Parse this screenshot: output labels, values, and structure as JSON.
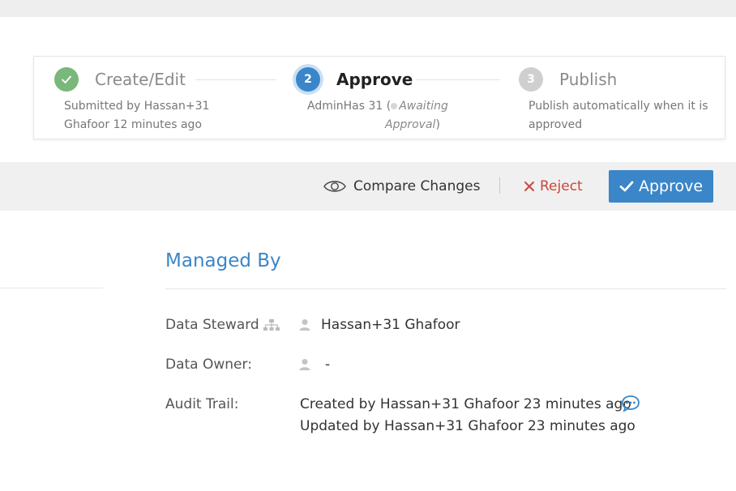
{
  "workflow": {
    "steps": [
      {
        "number": "1",
        "title": "Create/Edit",
        "state": "done",
        "desc_line1": "Submitted by Hassan+31",
        "desc_line2": "Ghafoor 12 minutes ago"
      },
      {
        "number": "2",
        "title": "Approve",
        "state": "active",
        "desc_prefix": "AdminHas 31 (",
        "status": "Awaiting",
        "status2": "Approval",
        "desc_suffix": ")"
      },
      {
        "number": "3",
        "title": "Publish",
        "state": "pending",
        "desc_line1": "Publish automatically when it is",
        "desc_line2": "approved"
      }
    ]
  },
  "actions": {
    "compare": "Compare Changes",
    "reject": "Reject",
    "approve": "Approve"
  },
  "managed_by": {
    "title": "Managed By",
    "data_steward_label": "Data Steward",
    "data_steward_value": "Hassan+31 Ghafoor",
    "data_owner_label": "Data Owner:",
    "data_owner_value": "-",
    "audit_label": "Audit Trail:",
    "audit_created": "Created by Hassan+31 Ghafoor 23 minutes ago",
    "audit_updated": "Updated by Hassan+31 Ghafoor 23 minutes ago"
  },
  "colors": {
    "accent": "#3a86c8",
    "done": "#79b87a",
    "reject": "#c9463d"
  },
  "icons": {
    "step1": "check-icon",
    "compare": "eye-icon",
    "reject": "x-icon",
    "approve": "check-icon",
    "steward_hierarchy": "hierarchy-icon",
    "user": "user-icon",
    "comment": "comment-icon"
  }
}
